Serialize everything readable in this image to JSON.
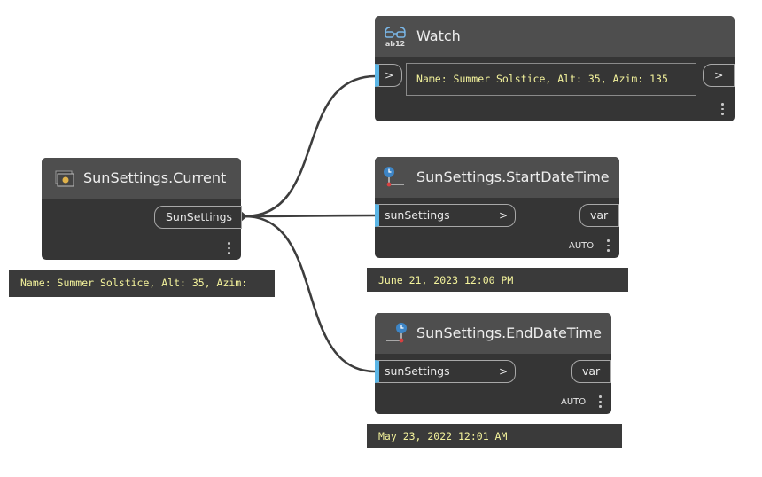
{
  "nodes": {
    "sun_current": {
      "title": "SunSettings.Current",
      "output_port": "SunSettings",
      "preview": "Name: Summer Solstice, Alt: 35, Azim:"
    },
    "watch": {
      "title": "Watch",
      "icon_text": "ab12",
      "input_port_arrow": ">",
      "output_port_arrow": ">",
      "value": "Name: Summer Solstice, Alt: 35, Azim: 135"
    },
    "start_date_time": {
      "title": "SunSettings.StartDateTime",
      "input_port": "sunSettings",
      "input_port_arrow": ">",
      "output_port": "var",
      "lacing": "AUTO",
      "preview": "June 21, 2023 12:00 PM"
    },
    "end_date_time": {
      "title": "SunSettings.EndDateTime",
      "input_port": "sunSettings",
      "input_port_arrow": ">",
      "output_port": "var",
      "lacing": "AUTO",
      "preview": "May 23, 2022 12:01 AM"
    }
  },
  "colors": {
    "node_body": "#353535",
    "node_header": "#4e4e4e",
    "wire": "#3d3d3d",
    "input_port_marker": "#5bb5e5",
    "preview_text": "#f4f39c"
  }
}
